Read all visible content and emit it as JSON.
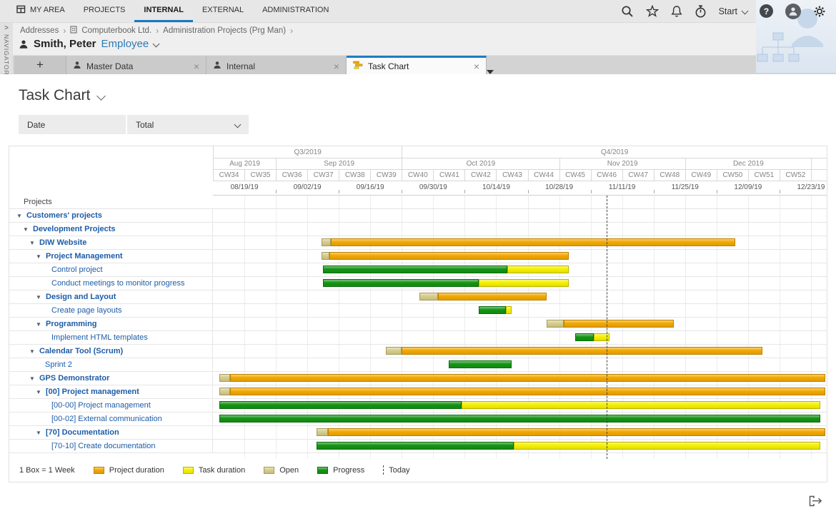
{
  "chrome": {
    "menu": {
      "items": [
        {
          "label": "MY AREA",
          "icon": "grid",
          "active": false
        },
        {
          "label": "PROJECTS",
          "active": false
        },
        {
          "label": "INTERNAL",
          "active": true
        },
        {
          "label": "EXTERNAL",
          "active": false
        },
        {
          "label": "ADMINISTRATION",
          "active": false
        }
      ],
      "right": {
        "start_label": "Start",
        "help_label": "?"
      }
    },
    "navigator_label": "NAVIGATOR",
    "breadcrumb": [
      {
        "label": "Addresses"
      },
      {
        "label": "Computerbook Ltd.",
        "icon": "building"
      },
      {
        "label": "Administration Projects (Prg Man)"
      }
    ],
    "person": {
      "name": "Smith, Peter",
      "role": "Employee"
    },
    "tabs": [
      {
        "label": "Master Data",
        "icon": "person",
        "active": false
      },
      {
        "label": "Internal",
        "icon": "person",
        "active": false
      },
      {
        "label": "Task Chart",
        "icon": "gantt",
        "active": true
      }
    ],
    "new_tab_label": "+"
  },
  "page": {
    "title": "Task Chart",
    "filters": {
      "date": "Date",
      "total": "Total"
    }
  },
  "icons": {
    "close": "×",
    "collapse_triangle": "▼",
    "breadcrumb_separator": "›",
    "navigator_chevron": ">"
  },
  "legend": {
    "scale_label": "1 Box = 1 Week",
    "items": [
      {
        "key": "project",
        "label": "Project duration",
        "color": "#F2A800"
      },
      {
        "key": "task",
        "label": "Task duration",
        "color": "#F5F000"
      },
      {
        "key": "open",
        "label": "Open",
        "color": "#D6CC8B"
      },
      {
        "key": "progress",
        "label": "Progress",
        "color": "#149414"
      },
      {
        "key": "today",
        "label": "Today",
        "color": "#444444"
      }
    ]
  },
  "chart_data": {
    "type": "gantt",
    "unit": "weeks_from_CW34_2019",
    "rows_header": "Projects",
    "timeline": {
      "total_weeks": 19.5,
      "quarters": [
        {
          "label": "Q3/2019",
          "start": 0,
          "end": 6
        },
        {
          "label": "Q4/2019",
          "start": 6,
          "end": 19.5
        }
      ],
      "months": [
        {
          "label": "Aug 2019",
          "start": 0,
          "end": 2
        },
        {
          "label": "Sep 2019",
          "start": 2,
          "end": 6
        },
        {
          "label": "Oct 2019",
          "start": 6,
          "end": 11
        },
        {
          "label": "Nov 2019",
          "start": 11,
          "end": 15
        },
        {
          "label": "Dec 2019",
          "start": 15,
          "end": 19
        },
        {
          "label": "",
          "start": 19,
          "end": 19.5
        }
      ],
      "weeks": [
        "CW34",
        "CW35",
        "CW36",
        "CW37",
        "CW38",
        "CW39",
        "CW40",
        "CW41",
        "CW42",
        "CW43",
        "CW44",
        "CW45",
        "CW46",
        "CW47",
        "CW48",
        "CW49",
        "CW50",
        "CW51",
        "CW52"
      ],
      "dates": [
        "08/19/19",
        "09/02/19",
        "09/16/19",
        "09/30/19",
        "10/14/19",
        "10/28/19",
        "11/11/19",
        "11/25/19",
        "12/09/19",
        "12/23/19"
      ],
      "today_week": 12.5
    },
    "rows": [
      {
        "label": "Customers' projects",
        "level": 0,
        "parent": true,
        "segments": []
      },
      {
        "label": "Development Projects",
        "level": 1,
        "parent": true,
        "segments": []
      },
      {
        "label": "DIW Website",
        "level": 2,
        "parent": true,
        "segments": [
          {
            "type": "open",
            "start": 3.45,
            "end": 3.75
          },
          {
            "type": "project",
            "start": 3.75,
            "end": 16.6
          }
        ]
      },
      {
        "label": "Project Management",
        "level": 3,
        "parent": true,
        "segments": [
          {
            "type": "open",
            "start": 3.45,
            "end": 3.7
          },
          {
            "type": "project",
            "start": 3.7,
            "end": 11.3
          }
        ]
      },
      {
        "label": "Control project",
        "level": 4,
        "parent": false,
        "segments": [
          {
            "type": "progress",
            "start": 3.5,
            "end": 9.35
          },
          {
            "type": "task",
            "start": 9.35,
            "end": 11.3
          }
        ]
      },
      {
        "label": "Conduct meetings to monitor progress",
        "level": 4,
        "parent": false,
        "segments": [
          {
            "type": "progress",
            "start": 3.5,
            "end": 8.45
          },
          {
            "type": "task",
            "start": 8.45,
            "end": 11.3
          }
        ]
      },
      {
        "label": "Design and Layout",
        "level": 3,
        "parent": true,
        "segments": [
          {
            "type": "open",
            "start": 6.55,
            "end": 7.15
          },
          {
            "type": "project",
            "start": 7.15,
            "end": 10.6
          }
        ]
      },
      {
        "label": "Create page layouts",
        "level": 4,
        "parent": false,
        "segments": [
          {
            "type": "progress",
            "start": 8.45,
            "end": 9.3
          },
          {
            "type": "task",
            "start": 9.3,
            "end": 9.5
          }
        ]
      },
      {
        "label": "Programming",
        "level": 3,
        "parent": true,
        "segments": [
          {
            "type": "open",
            "start": 10.6,
            "end": 11.15
          },
          {
            "type": "project",
            "start": 11.15,
            "end": 14.65
          }
        ]
      },
      {
        "label": "Implement HTML templates",
        "level": 4,
        "parent": false,
        "segments": [
          {
            "type": "progress",
            "start": 11.5,
            "end": 12.1
          },
          {
            "type": "task",
            "start": 12.1,
            "end": 12.6
          }
        ]
      },
      {
        "label": "Calendar Tool (Scrum)",
        "level": 2,
        "parent": true,
        "segments": [
          {
            "type": "open",
            "start": 5.5,
            "end": 6.0
          },
          {
            "type": "project",
            "start": 6.0,
            "end": 17.45
          }
        ]
      },
      {
        "label": "Sprint 2",
        "level": 3,
        "parent": false,
        "segments": [
          {
            "type": "progress",
            "start": 7.5,
            "end": 9.5
          }
        ]
      },
      {
        "label": "GPS Demonstrator",
        "level": 2,
        "parent": true,
        "segments": [
          {
            "type": "open",
            "start": 0.2,
            "end": 0.55
          },
          {
            "type": "project",
            "start": 0.55,
            "end": 19.45
          }
        ]
      },
      {
        "label": "[00] Project management",
        "level": 3,
        "parent": true,
        "segments": [
          {
            "type": "open",
            "start": 0.2,
            "end": 0.55
          },
          {
            "type": "project",
            "start": 0.55,
            "end": 19.45
          }
        ]
      },
      {
        "label": "[00-00] Project management",
        "level": 4,
        "parent": false,
        "segments": [
          {
            "type": "progress",
            "start": 0.2,
            "end": 7.9
          },
          {
            "type": "task",
            "start": 7.9,
            "end": 19.3
          }
        ]
      },
      {
        "label": "[00-02] External communication",
        "level": 4,
        "parent": false,
        "segments": [
          {
            "type": "progress",
            "start": 0.2,
            "end": 19.3
          }
        ]
      },
      {
        "label": "[70] Documentation",
        "level": 3,
        "parent": true,
        "segments": [
          {
            "type": "open",
            "start": 3.3,
            "end": 3.65
          },
          {
            "type": "project",
            "start": 3.65,
            "end": 19.45
          }
        ]
      },
      {
        "label": "[70-10] Create documentation",
        "level": 4,
        "parent": false,
        "segments": [
          {
            "type": "progress",
            "start": 3.3,
            "end": 9.55
          },
          {
            "type": "task",
            "start": 9.55,
            "end": 19.3
          }
        ]
      }
    ]
  }
}
